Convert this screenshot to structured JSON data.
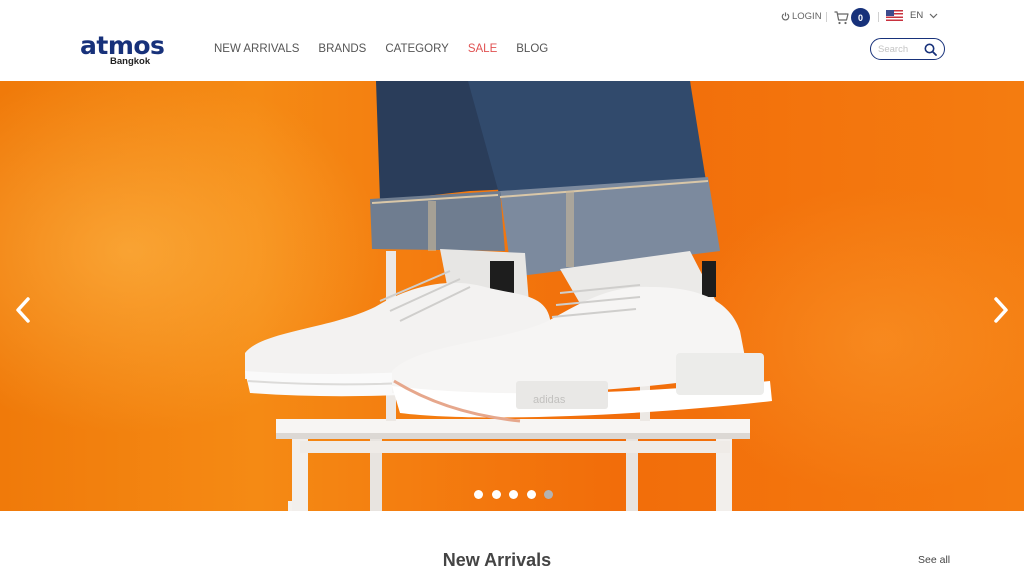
{
  "brand": {
    "name": "atmos",
    "location": "Bangkok",
    "color": "#17317a"
  },
  "header": {
    "nav": [
      {
        "label": "NEW ARRIVALS",
        "highlight": false
      },
      {
        "label": "BRANDS",
        "highlight": false
      },
      {
        "label": "CATEGORY",
        "highlight": false
      },
      {
        "label": "SALE",
        "highlight": true
      },
      {
        "label": "BLOG",
        "highlight": false
      }
    ],
    "login_label": "LOGIN",
    "cart_count": "0",
    "language": "EN",
    "search_placeholder": "Search"
  },
  "hero": {
    "slide_count": 5,
    "active_slide_index": 4,
    "prev_icon": "chevron-left-icon",
    "next_icon": "chevron-right-icon",
    "background_color": "#f27a0c",
    "shoe_text": "adidas"
  },
  "section": {
    "title": "New Arrivals",
    "see_all_label": "See all"
  },
  "colors": {
    "accent": "#17317a",
    "sale": "#e05252",
    "hero": "#f27a0c"
  }
}
